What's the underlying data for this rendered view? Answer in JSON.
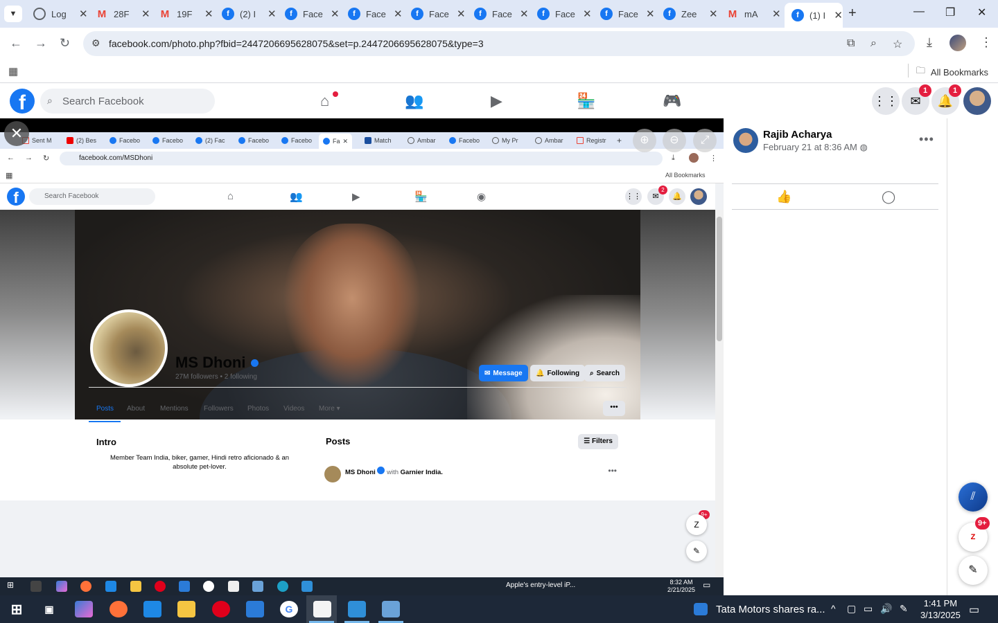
{
  "browser": {
    "tabs": [
      {
        "label": "Log",
        "icon": "globe-icon"
      },
      {
        "label": "28F",
        "icon": "gmail-icon"
      },
      {
        "label": "19F",
        "icon": "gmail-icon"
      },
      {
        "label": "(2) I",
        "icon": "facebook-icon"
      },
      {
        "label": "Face",
        "icon": "facebook-icon"
      },
      {
        "label": "Face",
        "icon": "facebook-icon"
      },
      {
        "label": "Face",
        "icon": "facebook-icon"
      },
      {
        "label": "Face",
        "icon": "facebook-icon"
      },
      {
        "label": "Face",
        "icon": "facebook-icon"
      },
      {
        "label": "Face",
        "icon": "facebook-icon"
      },
      {
        "label": "Zee",
        "icon": "facebook-icon"
      },
      {
        "label": "mA",
        "icon": "gmail-icon"
      },
      {
        "label": "(1) I",
        "icon": "facebook-icon"
      }
    ],
    "url": "facebook.com/photo.php?fbid=2447206695628075&set=p.2447206695628075&type=3",
    "bookmarks_label": "All Bookmarks"
  },
  "facebook": {
    "logo": "f",
    "search_placeholder": "Search Facebook",
    "messenger_badge": "1",
    "notifications_badge": "1"
  },
  "inner": {
    "tabs": [
      "Sent M",
      "(2) Bes",
      "Facebo",
      "Facebo",
      "(2) Fac",
      "Facebo",
      "Facebo",
      "Fa",
      "Match",
      "Ambar",
      "Facebo",
      "My Pr",
      "Ambar",
      "Registr"
    ],
    "url": "facebook.com/MSDhoni",
    "bookmarks_label": "All Bookmarks",
    "search_placeholder": "Search Facebook",
    "messenger_badge": "2",
    "profile": {
      "name": "MS Dhoni",
      "meta": "27M followers • 2 following",
      "btn_message": "Message",
      "btn_following": "Following",
      "btn_search": "Search",
      "tabs": [
        "Posts",
        "About",
        "Mentions",
        "Followers",
        "Photos",
        "Videos",
        "More"
      ],
      "more_dots": "•••",
      "intro_title": "Intro",
      "intro_text": "Member Team India, biker, gamer, Hindi retro aficionado & an absolute pet-lover.",
      "posts_title": "Posts",
      "filters": "Filters",
      "post_author": "MS Dhoni",
      "post_with": "with",
      "post_partner": "Garnier India.",
      "float_badge": "9+"
    },
    "taskbar": {
      "news": "Apple's entry-level iP...",
      "time": "8:32 AM",
      "date": "2/21/2025"
    }
  },
  "right_panel": {
    "author": "Rajib Acharya",
    "date": "February 21 at 8:36 AM",
    "side_badge": "9+"
  },
  "taskbar": {
    "news": "Tata Motors shares ra...",
    "time": "1:41 PM",
    "date": "3/13/2025"
  }
}
